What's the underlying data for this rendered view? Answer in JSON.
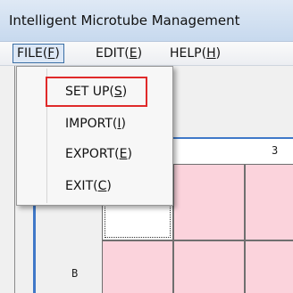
{
  "window": {
    "title": "Intelligent Microtube Management"
  },
  "menubar": {
    "items": [
      {
        "label": "FILE(",
        "key": "F",
        "suffix": ")"
      },
      {
        "label": "EDIT(",
        "key": "E",
        "suffix": ")"
      },
      {
        "label": "HELP(",
        "key": "H",
        "suffix": ")"
      }
    ]
  },
  "file_menu": {
    "items": [
      {
        "label": "SET UP(",
        "key": "S",
        "suffix": ")"
      },
      {
        "label": "IMPORT(",
        "key": "I",
        "suffix": ")"
      },
      {
        "label": "EXPORT(",
        "key": "E",
        "suffix": ")"
      },
      {
        "label": "EXIT(",
        "key": "C",
        "suffix": ")"
      }
    ],
    "highlighted_item": "SET UP(S)"
  },
  "grid": {
    "column_labels": [
      "3"
    ],
    "row_labels": [
      "B"
    ],
    "cell_color": "#fbd3dc"
  }
}
